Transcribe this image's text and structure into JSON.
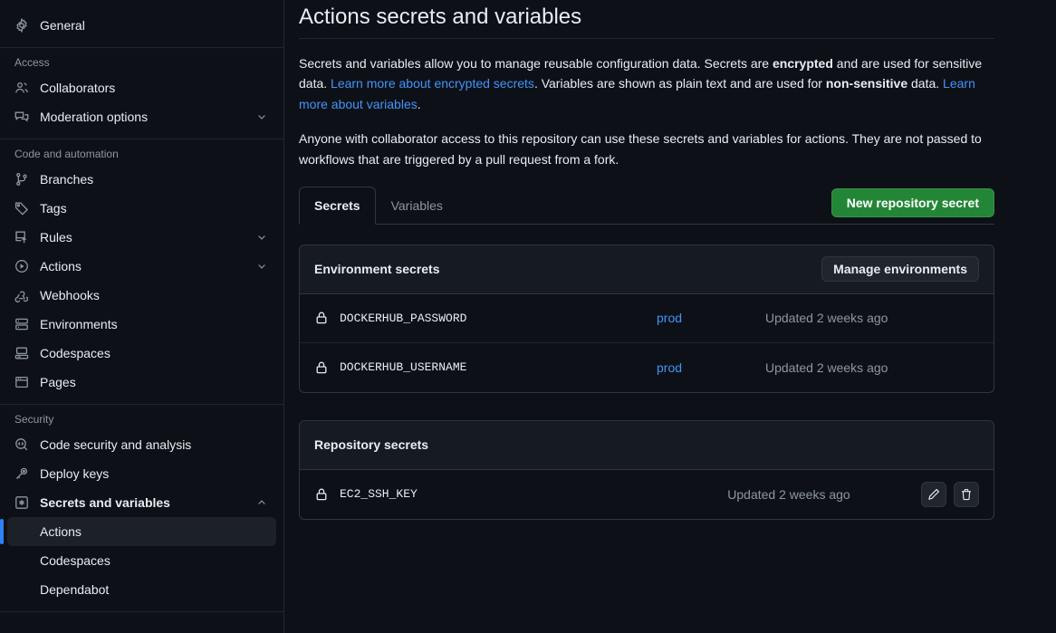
{
  "sidebar": {
    "top_items": [
      {
        "label": "General",
        "icon": "gear-icon",
        "name": "general"
      }
    ],
    "sections": [
      {
        "title": "Access",
        "items": [
          {
            "label": "Collaborators",
            "icon": "people-icon",
            "name": "collaborators",
            "chevron": ""
          },
          {
            "label": "Moderation options",
            "icon": "comment-discussion-icon",
            "name": "moderation-options",
            "chevron": "down"
          }
        ]
      },
      {
        "title": "Code and automation",
        "items": [
          {
            "label": "Branches",
            "icon": "git-branch-icon",
            "name": "branches",
            "chevron": ""
          },
          {
            "label": "Tags",
            "icon": "tag-icon",
            "name": "tags",
            "chevron": ""
          },
          {
            "label": "Rules",
            "icon": "rules-icon",
            "name": "rules",
            "chevron": "down"
          },
          {
            "label": "Actions",
            "icon": "play-icon",
            "name": "actions",
            "chevron": "down"
          },
          {
            "label": "Webhooks",
            "icon": "webhook-icon",
            "name": "webhooks",
            "chevron": ""
          },
          {
            "label": "Environments",
            "icon": "server-icon",
            "name": "environments",
            "chevron": ""
          },
          {
            "label": "Codespaces",
            "icon": "codespaces-icon",
            "name": "codespaces",
            "chevron": ""
          },
          {
            "label": "Pages",
            "icon": "browser-icon",
            "name": "pages",
            "chevron": ""
          }
        ]
      },
      {
        "title": "Security",
        "items": [
          {
            "label": "Code security and analysis",
            "icon": "code-scan-icon",
            "name": "code-security-and-analysis",
            "chevron": ""
          },
          {
            "label": "Deploy keys",
            "icon": "key-icon",
            "name": "deploy-keys",
            "chevron": ""
          },
          {
            "label": "Secrets and variables",
            "icon": "asterisk-box-icon",
            "name": "secrets-and-variables",
            "chevron": "up",
            "bold": true
          }
        ],
        "subitems": [
          {
            "label": "Actions",
            "name": "actions",
            "active": true
          },
          {
            "label": "Codespaces",
            "name": "codespaces",
            "active": false
          },
          {
            "label": "Dependabot",
            "name": "dependabot",
            "active": false
          }
        ]
      }
    ]
  },
  "main": {
    "title": "Actions secrets and variables",
    "paragraph1": {
      "t1": "Secrets and variables allow you to manage reusable configuration data. Secrets are ",
      "b1": "encrypted",
      "t2": " and are used for sensitive data. ",
      "link1": "Learn more about encrypted secrets",
      "t3": ". Variables are shown as plain text and are used for ",
      "b2": "non-sensitive",
      "t4": " data. ",
      "link2": "Learn more about variables",
      "t5": "."
    },
    "paragraph2": "Anyone with collaborator access to this repository can use these secrets and variables for actions. They are not passed to workflows that are triggered by a pull request from a fork.",
    "tabs": [
      {
        "label": "Secrets",
        "active": true,
        "name": "tab-secrets"
      },
      {
        "label": "Variables",
        "active": false,
        "name": "tab-variables"
      }
    ],
    "new_secret_button": "New repository secret",
    "environment_panel": {
      "title": "Environment secrets",
      "manage_button": "Manage environments",
      "rows": [
        {
          "name": "DOCKERHUB_PASSWORD",
          "environment": "prod",
          "updated": "Updated 2 weeks ago"
        },
        {
          "name": "DOCKERHUB_USERNAME",
          "environment": "prod",
          "updated": "Updated 2 weeks ago"
        }
      ]
    },
    "repository_panel": {
      "title": "Repository secrets",
      "rows": [
        {
          "name": "EC2_SSH_KEY",
          "updated": "Updated 2 weeks ago",
          "edit_icon": "pencil-icon",
          "delete_icon": "trash-icon"
        }
      ]
    }
  },
  "colors": {
    "page_bg": "#0d1117",
    "panel_header_bg": "#161b22",
    "border": "#30363d",
    "accent_green": "#238636",
    "link_blue": "#4493f8",
    "active_bar_blue": "#2f81f7",
    "muted_text": "#8d96a0"
  }
}
